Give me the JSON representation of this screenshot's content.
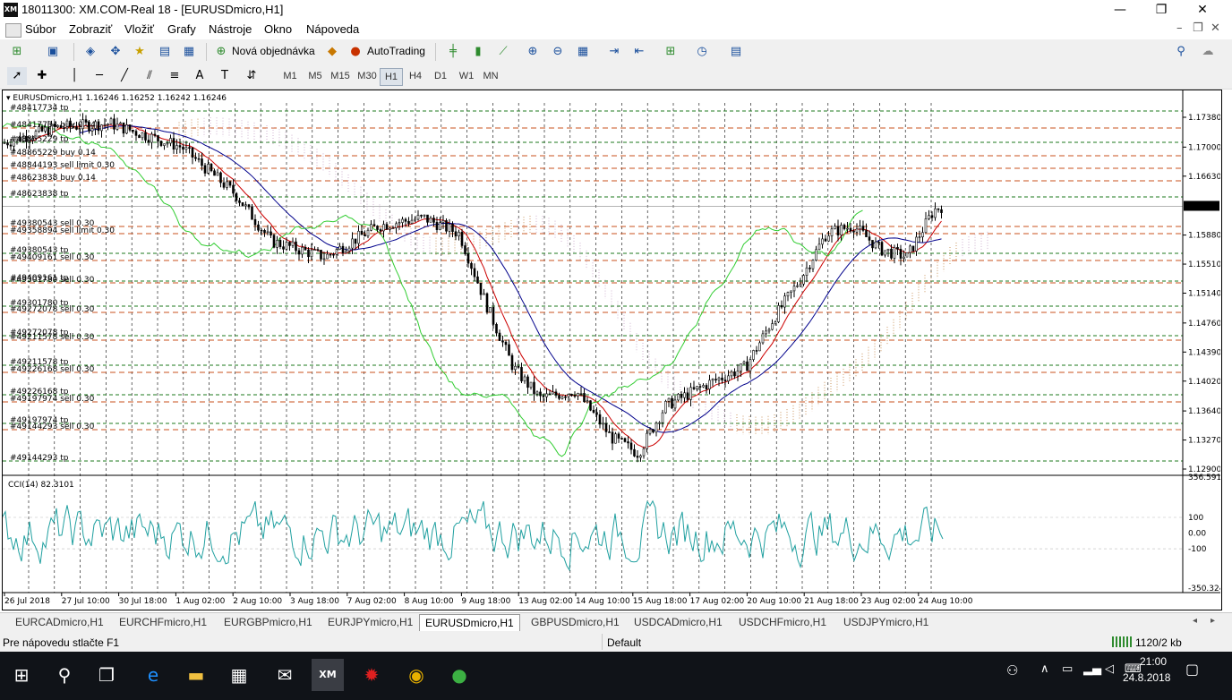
{
  "window": {
    "title": "18011300: XM.COM-Real 18 - [EURUSDmicro,H1]",
    "app_icon_text": "XM",
    "minimize": "—",
    "restore": "❐",
    "close": "✕",
    "mdi_min": "–",
    "mdi_restore": "❐",
    "mdi_close": "✕"
  },
  "menu": [
    "Súbor",
    "Zobraziť",
    "Vložiť",
    "Grafy",
    "Nástroje",
    "Okno",
    "Nápoveda"
  ],
  "toolbar": {
    "new_order": "Nová objednávka",
    "autotrading": "AutoTrading"
  },
  "timeframes": [
    "M1",
    "M5",
    "M15",
    "M30",
    "H1",
    "H4",
    "D1",
    "W1",
    "MN"
  ],
  "active_timeframe": "H1",
  "chart": {
    "header": "EURUSDmicro,H1  1.16246 1.16252 1.16242 1.16246",
    "current_price": "1.16246",
    "price_ticks": [
      "1.17380",
      "1.17000",
      "1.16630",
      "1.16246",
      "1.15880",
      "1.15510",
      "1.15140",
      "1.14760",
      "1.14390",
      "1.14020",
      "1.13640",
      "1.13270",
      "1.12900"
    ],
    "order_labels": [
      "#48417734 tp",
      "#48417734 buy 0.14",
      "#48865229 tp",
      "#48865229 buy 0.14",
      "#48844193 sell limit 0.30",
      "#48623838 buy 0.14",
      "#48623838 tp",
      "#49380543 sell 0.30",
      "#49358894 sell limit 0.30",
      "#49380543 tp",
      "#49409161 sell 0.30",
      "#49409161 tp",
      "#49301780 sell 0.30",
      "#49301780 tp",
      "#49272078 sell 0.30",
      "#49272078 tp",
      "#49211578 sell 0.30",
      "#49211578 tp",
      "#49226168 sell 0.30",
      "#49226168 tp",
      "#49197974 sell 0.30",
      "#49197974 tp",
      "#49144293 sell 0.30",
      "#49144293 tp"
    ],
    "indicator_header": "CCI(14) 82.3101",
    "cci_ticks": [
      "356.5913",
      "100",
      "0.00",
      "-100",
      "-350.324"
    ],
    "time_labels": [
      "26 Jul 2018",
      "27 Jul 10:00",
      "30 Jul 18:00",
      "1 Aug 02:00",
      "2 Aug 10:00",
      "3 Aug 18:00",
      "7 Aug 02:00",
      "8 Aug 10:00",
      "9 Aug 18:00",
      "13 Aug 02:00",
      "14 Aug 10:00",
      "15 Aug 18:00",
      "17 Aug 02:00",
      "20 Aug 10:00",
      "21 Aug 18:00",
      "23 Aug 02:00",
      "24 Aug 10:00"
    ],
    "colors": {
      "candles": "#000000",
      "chikou": "#32cd32",
      "tenkan": "#cc0000",
      "kijun": "#00008b",
      "kumo_up": "#d2a679",
      "kumo_down": "#d8bfd8",
      "sell_level": "#c8501e",
      "tp_level": "#1e7a1e",
      "cci": "#20a0a0"
    }
  },
  "tabs": [
    "EURCADmicro,H1",
    "EURCHFmicro,H1",
    "EURGBPmicro,H1",
    "EURJPYmicro,H1",
    "EURUSDmicro,H1",
    "GBPUSDmicro,H1",
    "USDCADmicro,H1",
    "USDCHFmicro,H1",
    "USDJPYmicro,H1"
  ],
  "active_tab": "EURUSDmicro,H1",
  "status": {
    "help": "Pre nápovedu stlačte F1",
    "profile": "Default",
    "traffic": "1120/2 kb"
  },
  "taskbar": {
    "time": "21:00",
    "date": "24.8.2018"
  }
}
